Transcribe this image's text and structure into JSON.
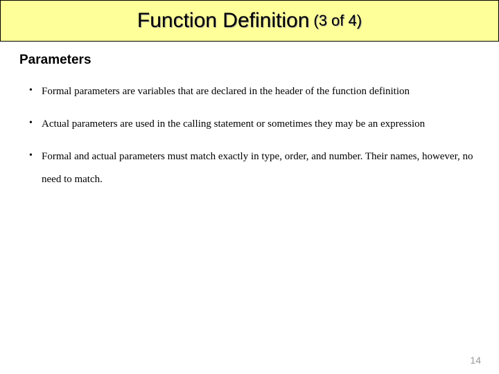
{
  "header": {
    "title_main": "Function Definition",
    "title_sub": "(3 of 4)"
  },
  "section": {
    "heading": "Parameters",
    "bullets": [
      "Formal parameters are variables that are declared in the header of the function definition",
      "Actual parameters are used in the calling statement  or sometimes they may be  an expression",
      "Formal and actual parameters must match exactly in type, order, and number. Their names, however, no need to match."
    ]
  },
  "page_number": "14"
}
